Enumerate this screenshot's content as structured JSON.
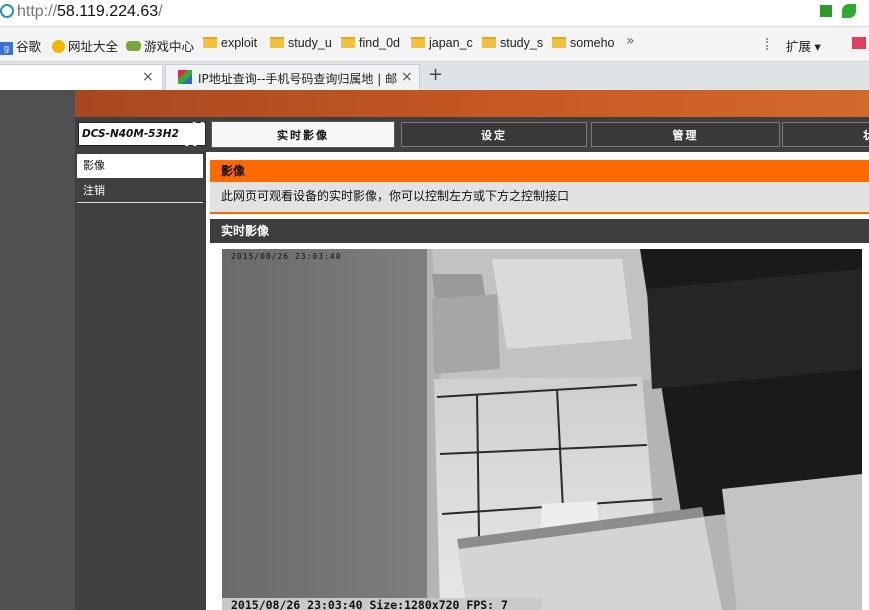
{
  "browser": {
    "address": {
      "url_host": "58.119.224.63",
      "url_prefix": "http://",
      "url_suffix": "/"
    },
    "bookmarks": [
      {
        "label": "谷歌",
        "icon": "google-icon"
      },
      {
        "label": "网址大全",
        "icon": "web-directory-icon"
      },
      {
        "label": "游戏中心",
        "icon": "gamepad-icon"
      },
      {
        "label": "exploit",
        "icon": "folder-icon"
      },
      {
        "label": "study_u",
        "icon": "folder-icon"
      },
      {
        "label": "find_0d",
        "icon": "folder-icon"
      },
      {
        "label": "japan_c",
        "icon": "folder-icon"
      },
      {
        "label": "study_s",
        "icon": "folder-icon"
      },
      {
        "label": "someho",
        "icon": "folder-icon"
      }
    ],
    "bookmarks_more": "»",
    "extensions_label": "扩展",
    "tabs": [
      {
        "title": "",
        "close": "×",
        "active": true
      },
      {
        "title": "IP地址查询--手机号码查询归属地 | 邮",
        "close": "×",
        "active": false
      }
    ],
    "new_tab": "+"
  },
  "camera": {
    "model": "DCS-N40M-53H2",
    "nav": [
      {
        "label": "实时影像",
        "active": true
      },
      {
        "label": "设定",
        "active": false
      },
      {
        "label": "管理",
        "active": false
      },
      {
        "label": "状",
        "active": false
      }
    ],
    "sidebar": [
      {
        "label": "影像",
        "active": true
      },
      {
        "label": "注销",
        "active": false
      }
    ],
    "section_title": "影像",
    "section_desc": "此网页可观看设备的实时影像，你可以控制左方或下方之控制接口",
    "live_title": "实时影像",
    "video": {
      "osd_top": "2015/08/26 23:03:40",
      "osd_bottom": "2015/08/26 23:03:40 Size:1280x720 FPS:  7"
    },
    "colors": {
      "header_orange": "#ff6a00",
      "nav_dark": "#404040",
      "banner": "#c95a24"
    }
  }
}
